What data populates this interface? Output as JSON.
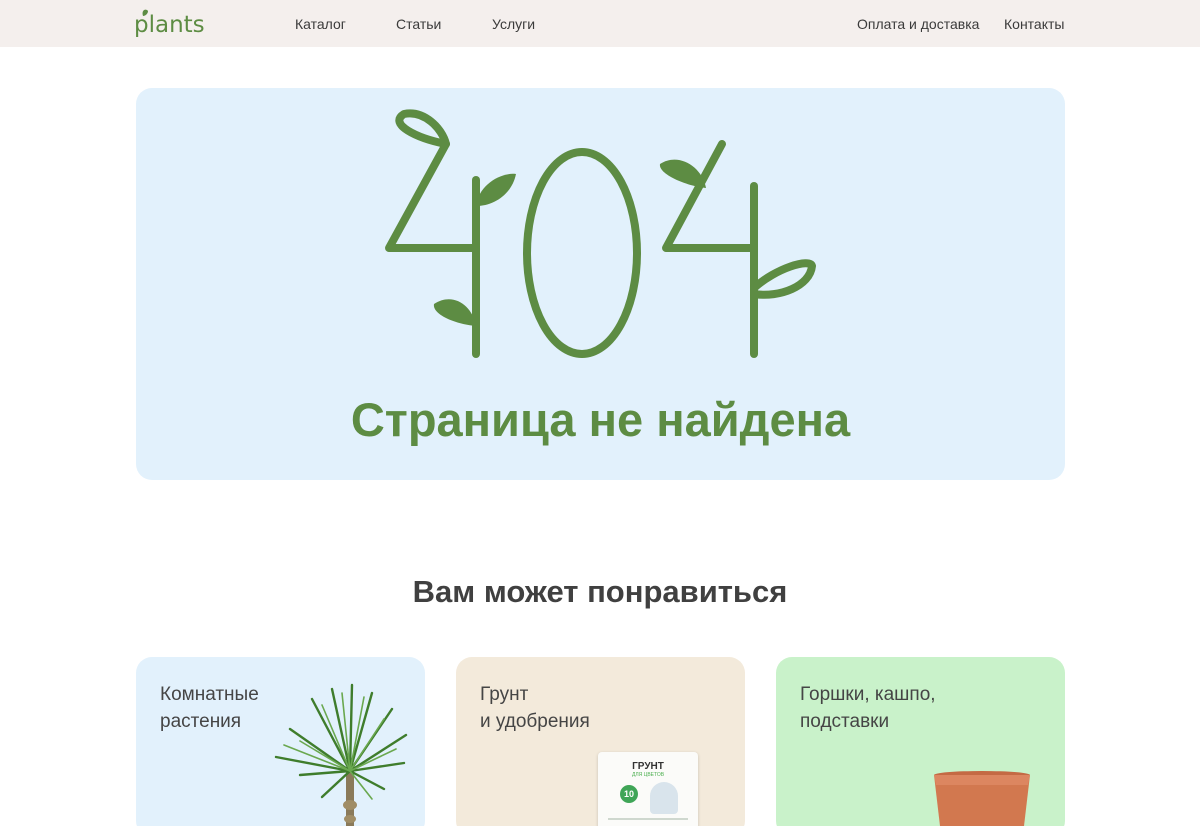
{
  "header": {
    "logo_text": "plants",
    "nav": [
      {
        "label": "Каталог"
      },
      {
        "label": "Статьи"
      },
      {
        "label": "Услуги"
      },
      {
        "label": "Оплата и доставка"
      },
      {
        "label": "Контакты"
      }
    ]
  },
  "hero": {
    "code": "404",
    "title": "Страница не найдена"
  },
  "recommendations": {
    "title": "Вам может понравиться",
    "cards": [
      {
        "title": "Комнатные\nрастения"
      },
      {
        "title": "Грунт\nи удобрения"
      },
      {
        "title": "Горшки, кашпо,\nподставки"
      }
    ],
    "soil_package": {
      "name": "ГРУНТ",
      "subtitle": "ДЛЯ ЦВЕТОВ",
      "volume": "10"
    }
  },
  "colors": {
    "accent_green": "#5d8c43",
    "header_bg": "#f4efed",
    "hero_bg": "#e2f1fc",
    "card_blue": "#e2f1fc",
    "card_beige": "#f3eadb",
    "card_green": "#c9f2ca"
  }
}
